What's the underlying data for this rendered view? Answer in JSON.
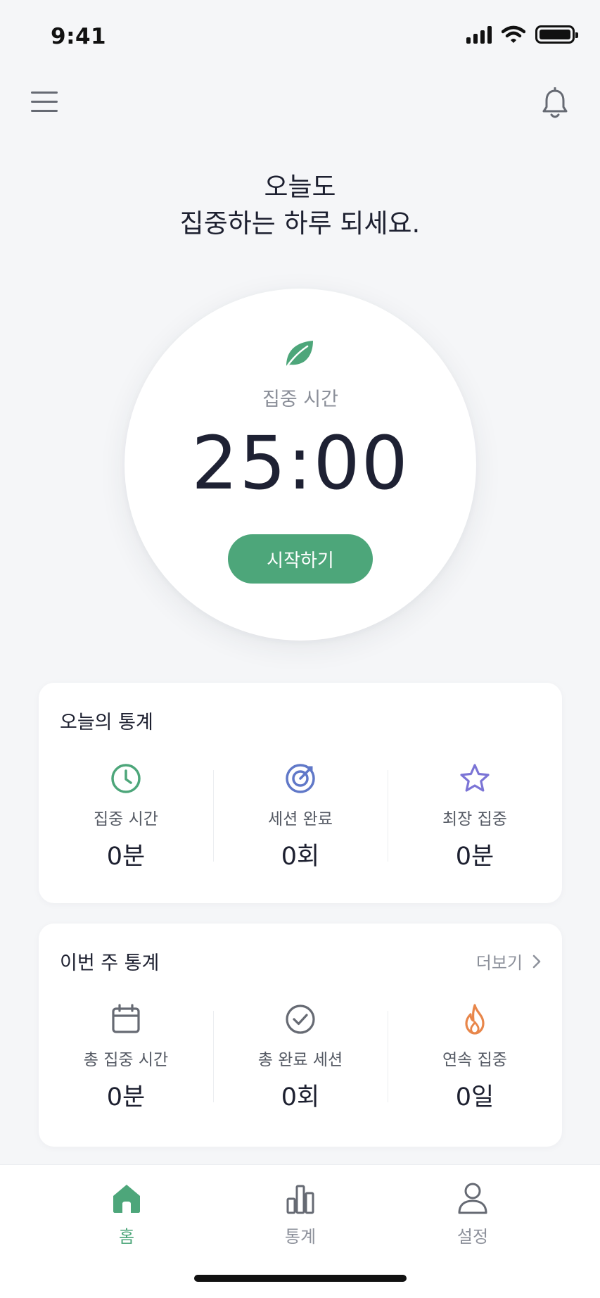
{
  "status_bar": {
    "time": "9:41"
  },
  "greeting": {
    "line1": "오늘도",
    "line2": "집중하는 하루 되세요."
  },
  "timer": {
    "label": "집중 시간",
    "value": "25:00",
    "start_label": "시작하기"
  },
  "today_stats": {
    "title": "오늘의 통계",
    "items": [
      {
        "icon": "clock-icon",
        "label": "집중 시간",
        "value": "0분"
      },
      {
        "icon": "target-icon",
        "label": "세션 완료",
        "value": "0회"
      },
      {
        "icon": "star-icon",
        "label": "최장 집중",
        "value": "0분"
      }
    ]
  },
  "week_stats": {
    "title": "이번 주 통계",
    "more_label": "더보기",
    "items": [
      {
        "icon": "calendar-icon",
        "label": "총 집중 시간",
        "value": "0분"
      },
      {
        "icon": "check-circle-icon",
        "label": "총 완료 세션",
        "value": "0회"
      },
      {
        "icon": "flame-icon",
        "label": "연속 집중",
        "value": "0일"
      }
    ]
  },
  "nav": {
    "items": [
      {
        "icon": "home-icon",
        "label": "홈",
        "active": true
      },
      {
        "icon": "bar-chart-icon",
        "label": "통계",
        "active": false
      },
      {
        "icon": "user-icon",
        "label": "설정",
        "active": false
      }
    ]
  },
  "colors": {
    "accent": "#4da67a",
    "background": "#f5f6f8",
    "target": "#6078c8",
    "star": "#7b74d6",
    "flame": "#e8864a"
  }
}
